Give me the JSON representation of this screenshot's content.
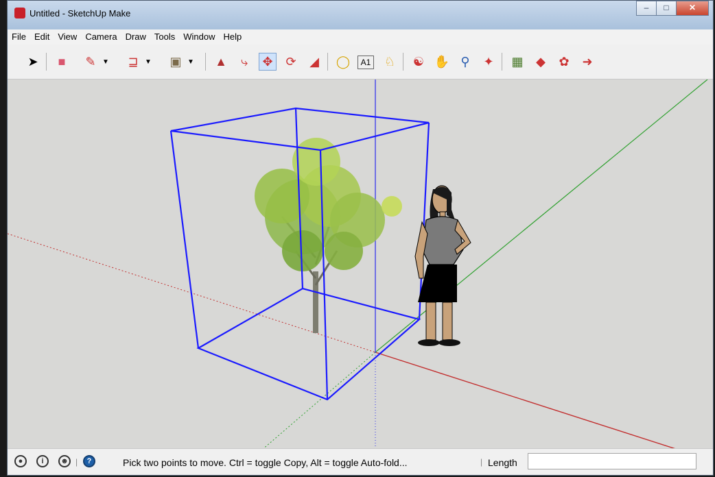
{
  "window": {
    "title": "Untitled - SketchUp Make"
  },
  "menu": [
    "File",
    "Edit",
    "View",
    "Camera",
    "Draw",
    "Tools",
    "Window",
    "Help"
  ],
  "toolbar": {
    "tools": [
      "select",
      "eraser",
      "pencil",
      "arc",
      "rectangle",
      "push-pull",
      "follow-me",
      "move",
      "rotate",
      "scale",
      "tape-measure",
      "text",
      "paint-bucket",
      "orbit",
      "pan",
      "zoom",
      "zoom-extents",
      "3d-warehouse",
      "extension-warehouse",
      "components",
      "share-model"
    ],
    "active_tool": "move"
  },
  "status": {
    "message": "Pick two points to move.  Ctrl = toggle Copy, Alt = toggle Auto-fold...",
    "vcb_label": "Length",
    "vcb_value": ""
  },
  "colors": {
    "axis_red": "#c23030",
    "axis_green": "#2ea02e",
    "axis_blue": "#2a2aee",
    "selection": "#1a1aff",
    "sky": "#d8d8d6"
  }
}
